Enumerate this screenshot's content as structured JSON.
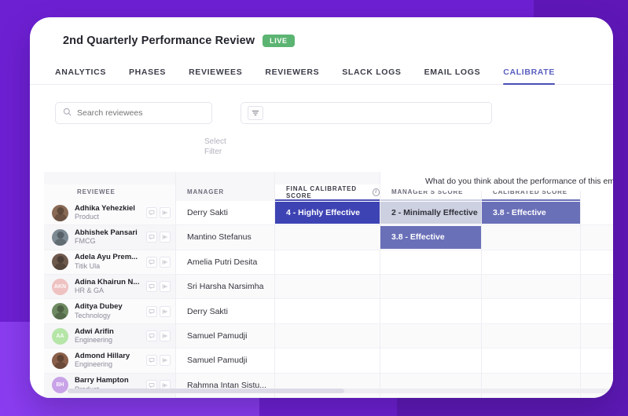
{
  "theme": {
    "background_purple": "#6d20d2",
    "band_light_purple": "#8a3df0",
    "band_dark_purple": "#5f17b8",
    "accent_indigo": "#4a4fb5",
    "live_green": "#5cb472",
    "chip_final_bg": "#3e43b4",
    "chip_manager_bg": "#ccd0e0",
    "chip_calibrated_bg": "#6a70b8"
  },
  "header": {
    "title": "2nd Quarterly Performance Review",
    "badge": "LIVE"
  },
  "tabs": [
    {
      "label": "ANALYTICS",
      "active": false
    },
    {
      "label": "PHASES",
      "active": false
    },
    {
      "label": "REVIEWEES",
      "active": false
    },
    {
      "label": "REVIEWERS",
      "active": false
    },
    {
      "label": "SLACK LOGS",
      "active": false
    },
    {
      "label": "EMAIL LOGS",
      "active": false
    },
    {
      "label": "CALIBRATE",
      "active": true
    }
  ],
  "toolbar": {
    "search_placeholder": "Search reviewees",
    "search_value": "",
    "select_filter_label": "Select Filter",
    "search_icon": "search-icon",
    "filter_icon": "filter-icon"
  },
  "table": {
    "question_header": "What do you think about the performance of this employee",
    "columns": {
      "reviewee": "REVIEWEE",
      "manager": "MANAGER",
      "final_calibrated_score": "FINAL CALIBRATED SCORE",
      "managers_score": "MANAGER'S SCORE",
      "calibrated_score": "CALIBRATED SCORE"
    },
    "info_icon": "info-icon",
    "row_action_icons": [
      "comment-icon",
      "collapse-left-icon"
    ],
    "rows": [
      {
        "name": "Adhika Yehezkiel",
        "dept": "Product",
        "avatar_type": "photo",
        "avatar_initials": "",
        "avatar_color": "#8a6a55",
        "manager": "Derry Sakti",
        "final_score": "4 - Highly Effective",
        "managers_score": "2 - Minimally Effective",
        "calibrated_score": "3.8 - Effective"
      },
      {
        "name": "Abhishek Pansari",
        "dept": "FMCG",
        "avatar_type": "photo",
        "avatar_initials": "",
        "avatar_color": "#7d8a93",
        "manager": "Mantino Stefanus",
        "final_score": "",
        "managers_score": "3.8 - Effective",
        "calibrated_score": ""
      },
      {
        "name": "Adela Ayu Prem...",
        "dept": "Titik Ula",
        "avatar_type": "photo",
        "avatar_initials": "",
        "avatar_color": "#6e5a4d",
        "manager": "Amelia Putri Desita",
        "final_score": "",
        "managers_score": "",
        "calibrated_score": ""
      },
      {
        "name": "Adina Khairun N...",
        "dept": "HR & GA",
        "avatar_type": "initials",
        "avatar_initials": "AKN",
        "avatar_color": "#efc2c2",
        "manager": "Sri Harsha Narsimha",
        "final_score": "",
        "managers_score": "",
        "calibrated_score": ""
      },
      {
        "name": "Aditya Dubey",
        "dept": "Technology",
        "avatar_type": "photo",
        "avatar_initials": "",
        "avatar_color": "#6f8a62",
        "manager": "Derry Sakti",
        "final_score": "",
        "managers_score": "",
        "calibrated_score": ""
      },
      {
        "name": "Adwi Arifin",
        "dept": "Engineering",
        "avatar_type": "initials",
        "avatar_initials": "AA",
        "avatar_color": "#b6e5a8",
        "manager": "Samuel Pamudji",
        "final_score": "",
        "managers_score": "",
        "calibrated_score": ""
      },
      {
        "name": "Admond Hillary",
        "dept": "Engineering",
        "avatar_type": "photo",
        "avatar_initials": "",
        "avatar_color": "#8a5f4a",
        "manager": "Samuel Pamudji",
        "final_score": "",
        "managers_score": "",
        "calibrated_score": ""
      },
      {
        "name": "Barry Hampton",
        "dept": "Product",
        "avatar_type": "initials",
        "avatar_initials": "BH",
        "avatar_color": "#c9a3e8",
        "manager": "Rahmna Intan Sistu...",
        "final_score": "",
        "managers_score": "",
        "calibrated_score": ""
      }
    ]
  }
}
